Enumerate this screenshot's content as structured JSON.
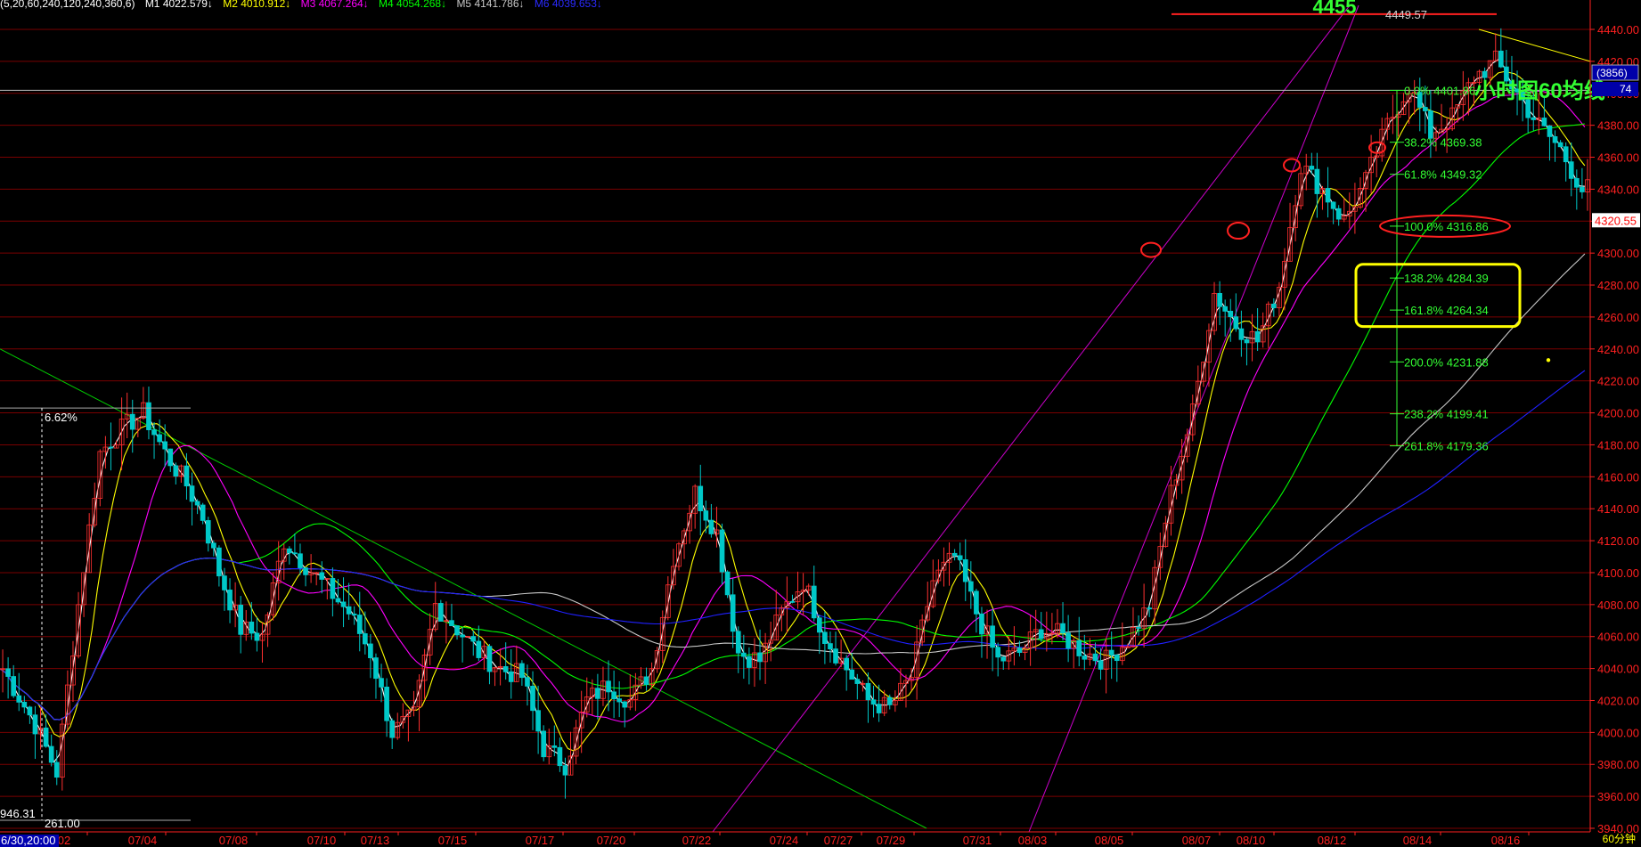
{
  "header": {
    "params": "(5,20,60,240,120,240,360,6)",
    "ma": [
      {
        "label": "M1 4022.579↓",
        "color": "#ffffff"
      },
      {
        "label": "M2 4010.912↓",
        "color": "#ffff00"
      },
      {
        "label": "M3 4067.264↓",
        "color": "#ff00ff"
      },
      {
        "label": "M4 4054.268↓",
        "color": "#00ff00"
      },
      {
        "label": "M5 4141.786↓",
        "color": "#c8c8c8"
      },
      {
        "label": "M6 4039.653↓",
        "color": "#2020ff"
      }
    ]
  },
  "annotations": {
    "peak_label": "4455",
    "peak_price": "4449.57",
    "hourly_title": "小时图60均线",
    "last_price": "4320.55",
    "badge": "(3856)",
    "badge2": "74",
    "pct_label": "6.62%",
    "low_price_label": "946.31",
    "low_ref_label": "261.00",
    "start_datetime": "6/30,20:00",
    "period": "60分钟"
  },
  "colors": {
    "background": "#000000",
    "grid": "#7a0000",
    "axis": "#ff2020",
    "fib": "#33ff33",
    "trend_green": "#00cc00",
    "trend_magenta": "#cc00cc",
    "ellipse": "#ff2020",
    "box": "#ffff00"
  },
  "chart_data": {
    "type": "candlestick",
    "timeframe": "60分钟",
    "y_ticks": [
      3940,
      3960,
      3980,
      4000,
      4020,
      4040,
      4060,
      4080,
      4100,
      4120,
      4140,
      4160,
      4180,
      4200,
      4220,
      4240,
      4260,
      4280,
      4300,
      4320,
      4340,
      4360,
      4380,
      4400,
      4420,
      4440
    ],
    "x_ticks": [
      "02",
      "07/04",
      "07/08",
      "07/10",
      "07/13",
      "07/15",
      "07/17",
      "07/20",
      "07/22",
      "07/24",
      "07/27",
      "07/29",
      "07/31",
      "08/03",
      "08/05",
      "08/07",
      "08/10",
      "08/12",
      "08/14",
      "08/16"
    ],
    "price_path": [
      [
        0,
        4040
      ],
      [
        6,
        4005
      ],
      [
        10,
        3975
      ],
      [
        14,
        4080
      ],
      [
        18,
        4175
      ],
      [
        22,
        4190
      ],
      [
        26,
        4200
      ],
      [
        30,
        4175
      ],
      [
        34,
        4155
      ],
      [
        37,
        4135
      ],
      [
        40,
        4100
      ],
      [
        44,
        4065
      ],
      [
        48,
        4060
      ],
      [
        52,
        4120
      ],
      [
        56,
        4105
      ],
      [
        60,
        4090
      ],
      [
        64,
        4075
      ],
      [
        68,
        4050
      ],
      [
        72,
        4000
      ],
      [
        76,
        4010
      ],
      [
        80,
        4080
      ],
      [
        84,
        4065
      ],
      [
        88,
        4050
      ],
      [
        92,
        4040
      ],
      [
        96,
        4035
      ],
      [
        100,
        3990
      ],
      [
        104,
        3980
      ],
      [
        108,
        4020
      ],
      [
        112,
        4030
      ],
      [
        116,
        4020
      ],
      [
        120,
        4040
      ],
      [
        124,
        4110
      ],
      [
        128,
        4150
      ],
      [
        132,
        4125
      ],
      [
        136,
        4050
      ],
      [
        140,
        4045
      ],
      [
        144,
        4075
      ],
      [
        148,
        4095
      ],
      [
        152,
        4060
      ],
      [
        156,
        4040
      ],
      [
        160,
        4020
      ],
      [
        164,
        4015
      ],
      [
        168,
        4035
      ],
      [
        172,
        4095
      ],
      [
        176,
        4110
      ],
      [
        180,
        4075
      ],
      [
        184,
        4045
      ],
      [
        188,
        4050
      ],
      [
        192,
        4065
      ],
      [
        196,
        4060
      ],
      [
        200,
        4050
      ],
      [
        204,
        4045
      ],
      [
        208,
        4058
      ],
      [
        212,
        4080
      ],
      [
        216,
        4150
      ],
      [
        220,
        4200
      ],
      [
        224,
        4275
      ],
      [
        228,
        4255
      ],
      [
        232,
        4245
      ],
      [
        236,
        4280
      ],
      [
        240,
        4355
      ],
      [
        244,
        4340
      ],
      [
        248,
        4320
      ],
      [
        252,
        4345
      ],
      [
        256,
        4380
      ],
      [
        260,
        4405
      ],
      [
        264,
        4375
      ],
      [
        268,
        4385
      ],
      [
        272,
        4410
      ],
      [
        276,
        4420
      ],
      [
        280,
        4400
      ],
      [
        284,
        4380
      ],
      [
        288,
        4365
      ],
      [
        292,
        4340
      ]
    ],
    "moving_averages": [
      {
        "name": "M1",
        "period": 5,
        "value": 4022.579,
        "color": "#ffffff"
      },
      {
        "name": "M2",
        "period": 20,
        "value": 4010.912,
        "color": "#ffff00"
      },
      {
        "name": "M3",
        "period": 60,
        "value": 4067.264,
        "color": "#ff00ff"
      },
      {
        "name": "M4",
        "period": 240,
        "value": 4054.268,
        "color": "#00ff00"
      },
      {
        "name": "M5",
        "period": 120,
        "value": 4141.786,
        "color": "#c8c8c8"
      },
      {
        "name": "M6",
        "period": 360,
        "value": 4039.653,
        "color": "#2020ff"
      }
    ],
    "fibonacci": [
      {
        "label": "0.0% 4401.86",
        "value": 4401.86
      },
      {
        "label": "38.2% 4369.38",
        "value": 4369.38
      },
      {
        "label": "61.8% 4349.32",
        "value": 4349.32
      },
      {
        "label": "100.0% 4316.86",
        "value": 4316.86
      },
      {
        "label": "138.2% 4284.39",
        "value": 4284.39
      },
      {
        "label": "161.8% 4264.34",
        "value": 4264.34
      },
      {
        "label": "200.0% 4231.88",
        "value": 4231.88
      },
      {
        "label": "238.2% 4199.41",
        "value": 4199.41
      },
      {
        "label": "261.8% 4179.36",
        "value": 4179.36
      }
    ],
    "peak": 4449.57,
    "last": 4320.55
  }
}
